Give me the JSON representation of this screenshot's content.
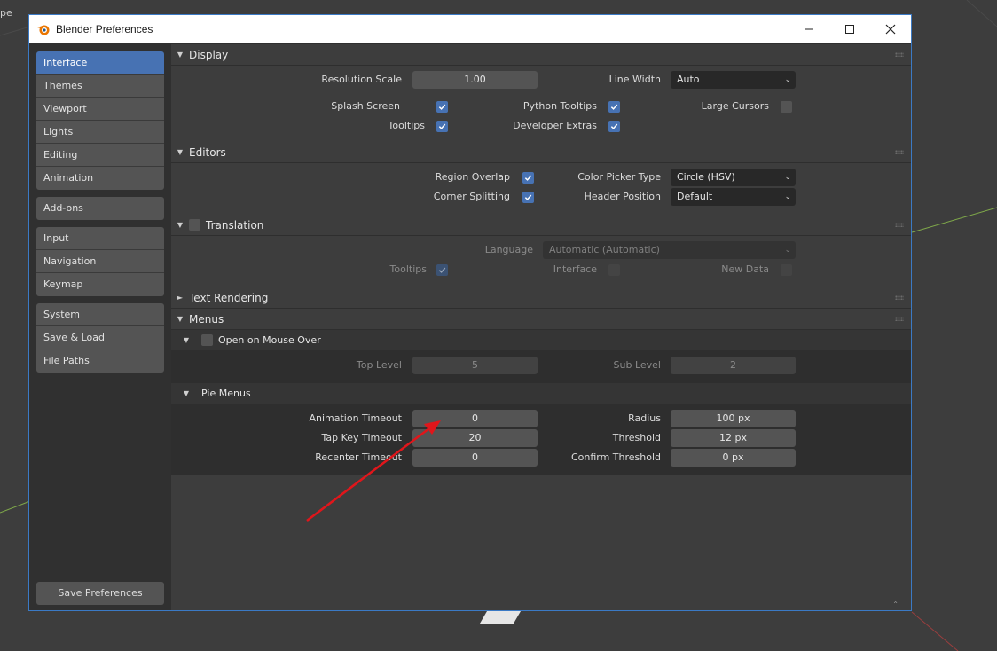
{
  "bg_text": "pe",
  "window": {
    "title": "Blender Preferences",
    "minimize_label": "",
    "maximize_label": "",
    "close_label": ""
  },
  "sidebar": {
    "groups": [
      [
        "Interface",
        "Themes",
        "Viewport",
        "Lights",
        "Editing",
        "Animation"
      ],
      [
        "Add-ons"
      ],
      [
        "Input",
        "Navigation",
        "Keymap"
      ],
      [
        "System",
        "Save & Load",
        "File Paths"
      ]
    ],
    "active": "Interface",
    "save_button": "Save Preferences"
  },
  "display": {
    "title": "Display",
    "resolution_scale_label": "Resolution Scale",
    "resolution_scale_value": "1.00",
    "line_width_label": "Line Width",
    "line_width_value": "Auto",
    "splash_screen_label": "Splash Screen",
    "python_tooltips_label": "Python Tooltips",
    "large_cursors_label": "Large Cursors",
    "tooltips_label": "Tooltips",
    "developer_extras_label": "Developer Extras",
    "splash_screen": true,
    "python_tooltips": true,
    "large_cursors": false,
    "tooltips": true,
    "developer_extras": true
  },
  "editors": {
    "title": "Editors",
    "region_overlap_label": "Region Overlap",
    "corner_splitting_label": "Corner Splitting",
    "color_picker_label": "Color Picker Type",
    "color_picker_value": "Circle (HSV)",
    "header_position_label": "Header Position",
    "header_position_value": "Default",
    "region_overlap": true,
    "corner_splitting": true
  },
  "translation": {
    "title": "Translation",
    "enabled": false,
    "language_label": "Language",
    "language_value": "Automatic (Automatic)",
    "tooltips_label": "Tooltips",
    "interface_label": "Interface",
    "new_data_label": "New Data",
    "tooltips": true,
    "interface": false,
    "new_data": false
  },
  "text_rendering": {
    "title": "Text Rendering"
  },
  "menus": {
    "title": "Menus",
    "open_on_mouse_over": {
      "title": "Open on Mouse Over",
      "enabled": false,
      "top_level_label": "Top Level",
      "top_level_value": "5",
      "sub_level_label": "Sub Level",
      "sub_level_value": "2"
    },
    "pie_menus": {
      "title": "Pie Menus",
      "animation_timeout_label": "Animation Timeout",
      "animation_timeout_value": "0",
      "tap_key_timeout_label": "Tap Key Timeout",
      "tap_key_timeout_value": "20",
      "recenter_timeout_label": "Recenter Timeout",
      "recenter_timeout_value": "0",
      "radius_label": "Radius",
      "radius_value": "100 px",
      "threshold_label": "Threshold",
      "threshold_value": "12 px",
      "confirm_threshold_label": "Confirm Threshold",
      "confirm_threshold_value": "0 px"
    }
  },
  "colors": {
    "accent": "#4772b3",
    "annotation_arrow": "#e0161b",
    "window_border": "#3b7ac5"
  }
}
